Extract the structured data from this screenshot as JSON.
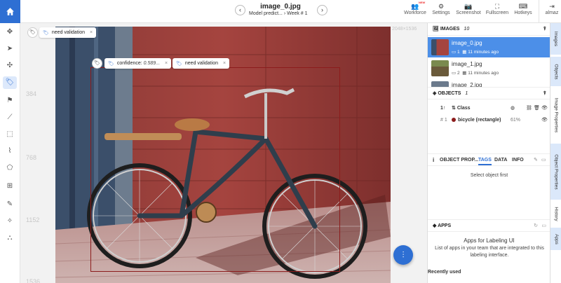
{
  "header": {
    "title": "image_0.jpg",
    "project": "Model predict...",
    "dataset": "Week # 1",
    "new_badge": "NEW",
    "user": "almaz",
    "tools": [
      {
        "label": "Workforce",
        "icon": "team-icon"
      },
      {
        "label": "Settings",
        "icon": "gear-icon"
      },
      {
        "label": "Screenshot",
        "icon": "camera-icon"
      },
      {
        "label": "Fullscreen",
        "icon": "fullscreen-icon"
      },
      {
        "label": "Hotkeys",
        "icon": "keyboard-icon"
      }
    ]
  },
  "canvas": {
    "rulers": [
      "384",
      "768",
      "1152",
      "1536"
    ],
    "dimensions": "2048×1536",
    "image_tag": "need validation",
    "object_tags": {
      "confidence_label": "confidence:",
      "confidence_value": "0.589...",
      "validation": "need validation"
    }
  },
  "images": {
    "title": "IMAGES",
    "count": "10",
    "items": [
      {
        "name": "image_0.jpg",
        "objects": "1",
        "time": "11 minutes ago"
      },
      {
        "name": "image_1.jpg",
        "objects": "2",
        "time": "11 minutes ago"
      },
      {
        "name": "image_2.jpg",
        "objects": "",
        "time": ""
      }
    ]
  },
  "objects": {
    "title": "OBJECTS",
    "count": "1",
    "header": {
      "sort": "1↑",
      "class": "Class"
    },
    "rows": [
      {
        "num": "# 1",
        "name": "bicycle (rectangle)",
        "pct": "61%"
      }
    ]
  },
  "properties": {
    "title": "OBJECT PROP...",
    "tabs": [
      "TAGS",
      "DATA",
      "INFO"
    ],
    "empty": "Select object first"
  },
  "apps": {
    "title": "APPS",
    "heading": "Apps for Labeling UI",
    "desc": "List of apps in your team that are integrated to this labeling interface.",
    "recent": "Recently used"
  },
  "right_tabs": [
    "Images",
    "Objects",
    "Image Properties",
    "Object Properties",
    "History",
    "Apps"
  ],
  "colors": {
    "accent": "#2e6fd3",
    "bbox": "#8c1c1c",
    "selected": "#4c8fe8"
  }
}
